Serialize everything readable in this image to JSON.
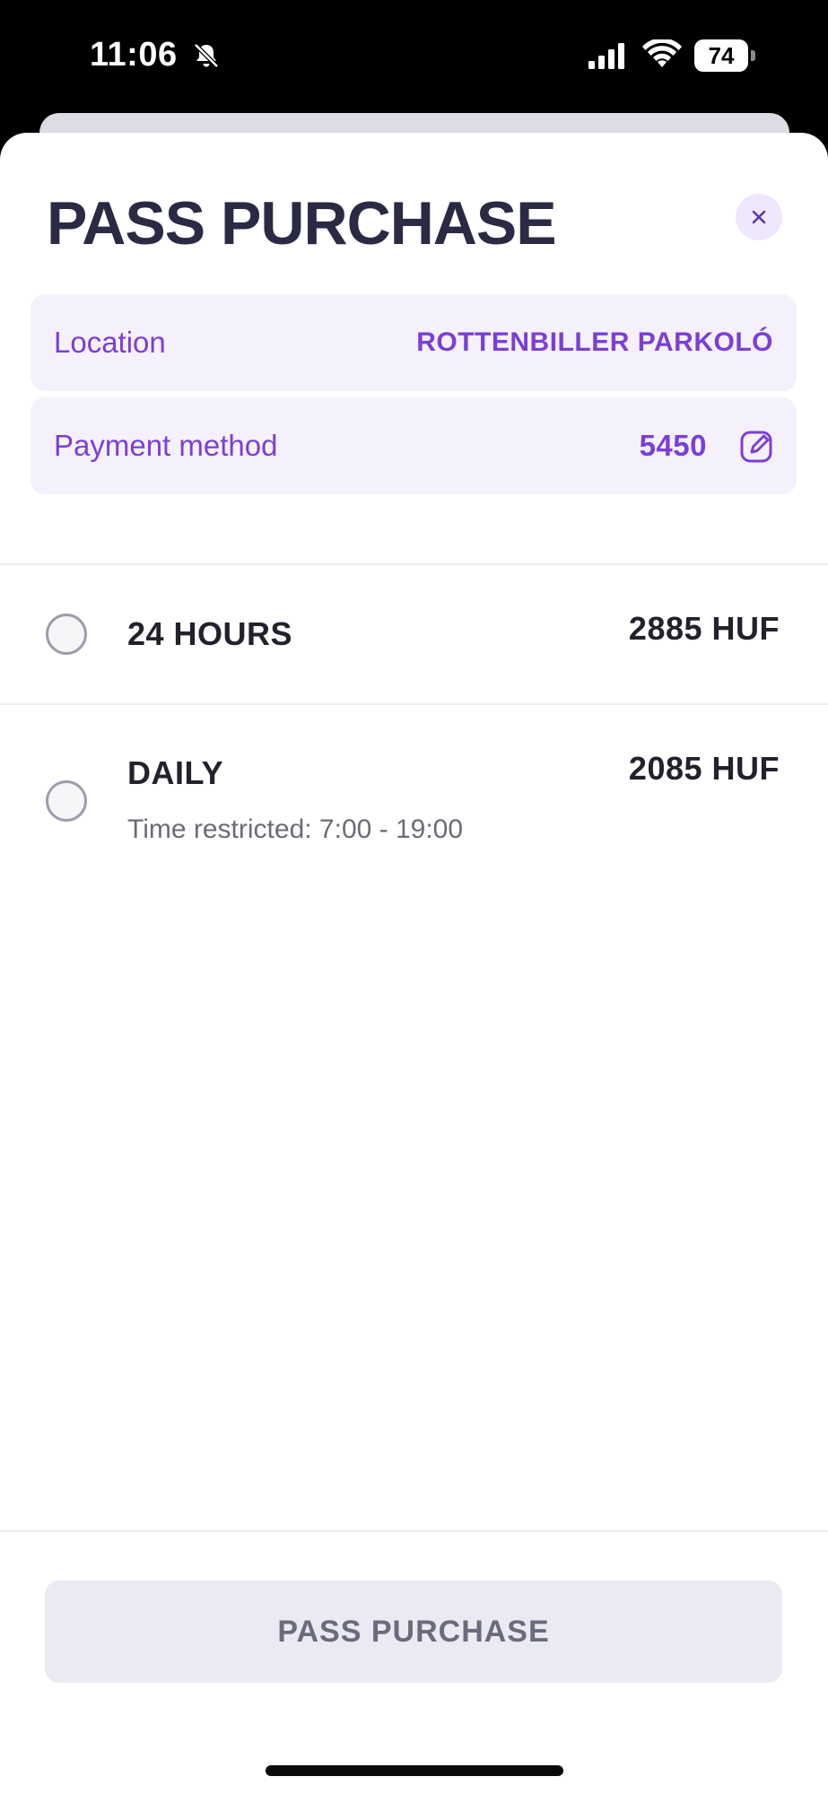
{
  "status_bar": {
    "time": "11:06",
    "battery": "74",
    "icons": [
      "bell-off-icon",
      "cellular-signal-icon",
      "wifi-icon",
      "battery-icon"
    ]
  },
  "header": {
    "title": "PASS PURCHASE",
    "close_icon": "close-icon"
  },
  "info": {
    "location_label": "Location",
    "location_value": "ROTTENBILLER PARKOLÓ",
    "payment_label": "Payment method",
    "payment_value": "5450",
    "payment_edit_icon": "edit-icon"
  },
  "options": [
    {
      "name": "24 HOURS",
      "price": "2885 HUF",
      "selected": false
    },
    {
      "name": "DAILY",
      "price": "2085 HUF",
      "subtitle": "Time restricted: 7:00 - 19:00",
      "selected": false
    }
  ],
  "footer": {
    "button_label": "PASS PURCHASE"
  },
  "colors": {
    "accent": "#7b3fd6",
    "title": "#2a2a44",
    "card_background": "#f5f1fc",
    "button_disabled_background": "#eaeaf2",
    "button_disabled_text": "#6b6b7d"
  }
}
